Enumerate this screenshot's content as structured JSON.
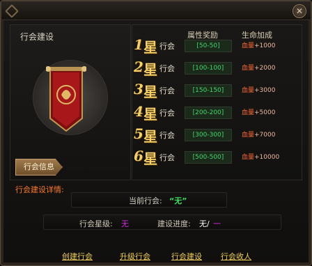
{
  "window": {
    "close_glyph": "✕"
  },
  "left_panel": {
    "title": "行会建设",
    "info_tab": "行会信息"
  },
  "table": {
    "headers": {
      "attr": "属性奖励",
      "life": "生命加成"
    },
    "rows": [
      {
        "star": "1",
        "star_char": "星",
        "guild": "行会",
        "attr": "[50-50]",
        "life_label": "血量",
        "life_value": "+1000"
      },
      {
        "star": "2",
        "star_char": "星",
        "guild": "行会",
        "attr": "[100-100]",
        "life_label": "血量",
        "life_value": "+2000"
      },
      {
        "star": "3",
        "star_char": "星",
        "guild": "行会",
        "attr": "[150-150]",
        "life_label": "血量",
        "life_value": "+3000"
      },
      {
        "star": "4",
        "star_char": "星",
        "guild": "行会",
        "attr": "[200-200]",
        "life_label": "血量",
        "life_value": "+5000"
      },
      {
        "star": "5",
        "star_char": "星",
        "guild": "行会",
        "attr": "[300-300]",
        "life_label": "血量",
        "life_value": "+7000"
      },
      {
        "star": "6",
        "star_char": "星",
        "guild": "行会",
        "attr": "[500-500]",
        "life_label": "血量",
        "life_value": "+10000"
      }
    ]
  },
  "details": {
    "title": "行会建设详情:",
    "current_label": "当前行会:",
    "current_value": "“无”",
    "star_label": "行会星级:",
    "star_value": "无",
    "progress_label": "建设进度:",
    "progress_value": "无/",
    "progress_total": "一"
  },
  "links": [
    "创建行会",
    "升级行会",
    "行会建设",
    "行会收人"
  ],
  "colors": {
    "gold": "#f4cf68",
    "green": "#41d86a",
    "red": "#ff6e2f",
    "purple": "#d52adf"
  }
}
